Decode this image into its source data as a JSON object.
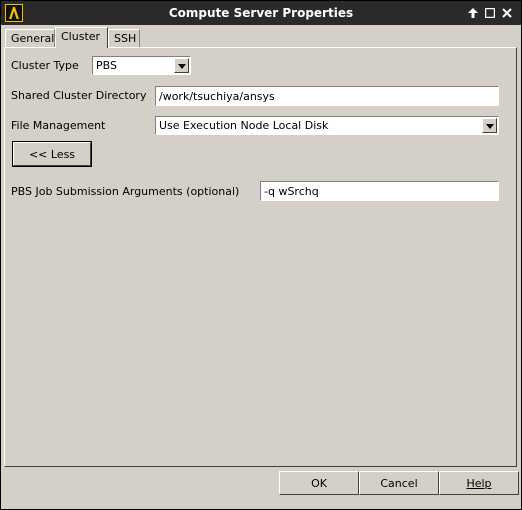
{
  "window": {
    "title": "Compute Server Properties"
  },
  "titlebar": {
    "pin_glyph": "🡑",
    "maximize_glyph": "☐",
    "close_glyph": "✕"
  },
  "tabs": [
    {
      "label": "General"
    },
    {
      "label": "Cluster"
    },
    {
      "label": "SSH"
    }
  ],
  "cluster": {
    "cluster_type_label": "Cluster Type",
    "cluster_type_value": "PBS",
    "shared_dir_label": "Shared Cluster Directory",
    "shared_dir_value": "/work/tsuchiya/ansys",
    "file_mgmt_label": "File Management",
    "file_mgmt_value": "Use Execution Node Local Disk",
    "less_button": "<< Less",
    "pbs_args_label": "PBS Job Submission Arguments (optional)",
    "pbs_args_value": "-q wSrchq"
  },
  "buttons": {
    "ok": "OK",
    "cancel": "Cancel",
    "help": "Help"
  },
  "colors": {
    "background": "#d4d0c8",
    "titlebar": "#2a2a2a",
    "icon_accent": "#f0c000"
  }
}
